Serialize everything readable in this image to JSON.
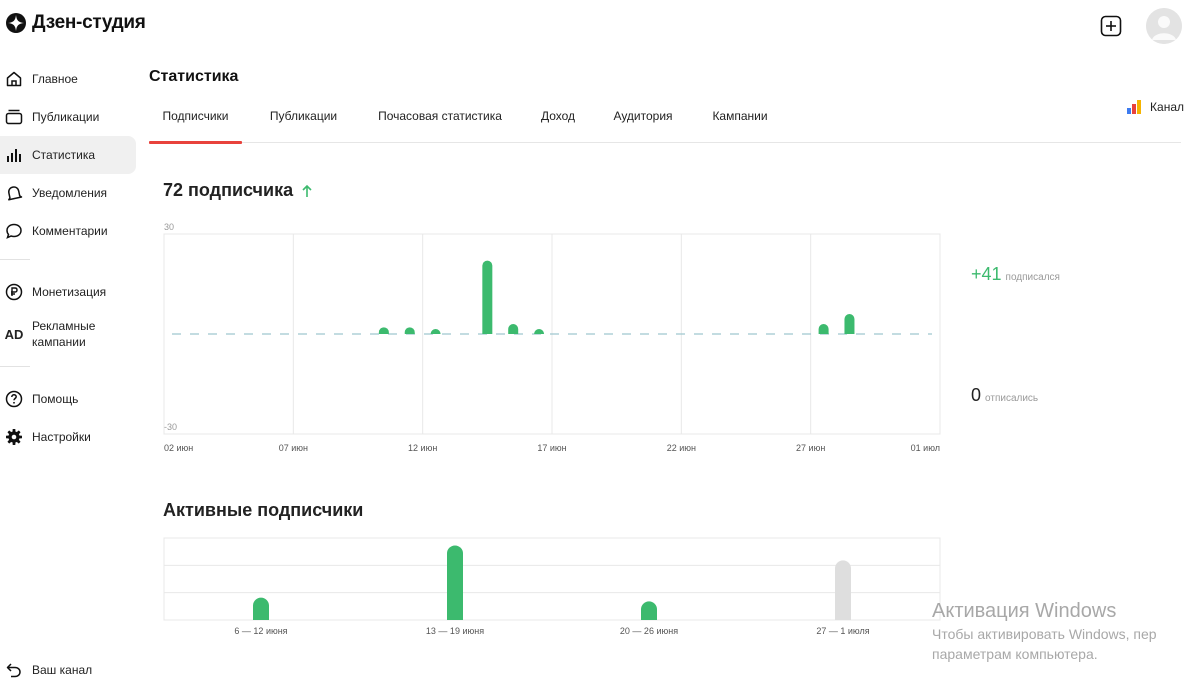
{
  "app": {
    "logo_text": "Дзен-студия"
  },
  "sidebar": {
    "items": [
      {
        "label": "Главное",
        "icon": "home-icon"
      },
      {
        "label": "Публикации",
        "icon": "publications-icon"
      },
      {
        "label": "Статистика",
        "icon": "stats-icon",
        "active": true
      },
      {
        "label": "Уведомления",
        "icon": "bell-icon"
      },
      {
        "label": "Комментарии",
        "icon": "comment-icon"
      },
      {
        "label": "Монетизация",
        "icon": "ruble-icon"
      },
      {
        "label": "Рекламные кампании",
        "icon": "ad-icon",
        "ad_text": "AD"
      },
      {
        "label": "Помощь",
        "icon": "help-icon"
      },
      {
        "label": "Настройки",
        "icon": "gear-icon"
      }
    ],
    "bottom": {
      "label": "Ваш канал",
      "icon": "back-arrow-icon"
    }
  },
  "page": {
    "title": "Статистика"
  },
  "tabs": [
    {
      "label": "Подписчики",
      "active": true
    },
    {
      "label": "Публикации"
    },
    {
      "label": "Почасовая статистика"
    },
    {
      "label": "Доход"
    },
    {
      "label": "Аудитория"
    },
    {
      "label": "Кампании"
    }
  ],
  "channel_button": {
    "label": "Канал",
    "icon": "bar-chart-color-icon"
  },
  "subscribers": {
    "title": "72 подписчика",
    "trend_icon": "arrow-up-icon",
    "subscribed_value": "+41",
    "subscribed_label": "подписался",
    "unsubscribed_value": "0",
    "unsubscribed_label": "отписались"
  },
  "active": {
    "title": "Активные подписчики"
  },
  "chart_data": [
    {
      "type": "bar",
      "ylim": [
        -30,
        30
      ],
      "ytick_top": "30",
      "ytick_bottom": "-30",
      "x_ticks": [
        "02 июн",
        "07 июн",
        "12 июн",
        "17 июн",
        "22 июн",
        "27 июн",
        "01 июл"
      ],
      "bars": [
        {
          "day_index": 8.5,
          "value": 2
        },
        {
          "day_index": 9.5,
          "value": 2
        },
        {
          "day_index": 10.5,
          "value": 1
        },
        {
          "day_index": 12.5,
          "value": 22
        },
        {
          "day_index": 13.5,
          "value": 3
        },
        {
          "day_index": 14.5,
          "value": 1
        },
        {
          "day_index": 25.5,
          "value": 3
        },
        {
          "day_index": 26.5,
          "value": 6
        }
      ],
      "x_domain": [
        0,
        30
      ],
      "colors": {
        "bar": "#3cba6e",
        "zero_line": "#9fc8cf",
        "grid": "#e8e8e8"
      }
    },
    {
      "type": "bar",
      "categories": [
        "6 — 12 июня",
        "13 — 19 июня",
        "20 — 26 июня",
        "27 — 1 июля"
      ],
      "values": [
        6,
        20,
        5,
        16
      ],
      "ylim": [
        0,
        22
      ],
      "colors": {
        "bar": "#3cba6e",
        "bar_incomplete": "#dedede",
        "grid": "#e8e8e8"
      }
    }
  ],
  "watermark": {
    "line1": "Активация Windows",
    "line2": "Чтобы активировать Windows, пер",
    "line3": "параметрам компьютера."
  }
}
